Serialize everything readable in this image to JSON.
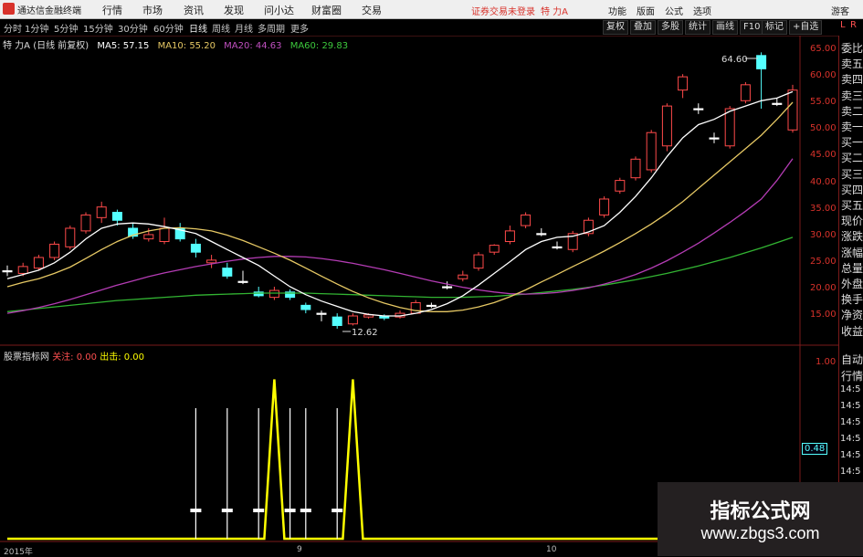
{
  "titlebar": {
    "app_name": "通达信金融终端",
    "menus": [
      "行情",
      "市场",
      "资讯",
      "发现",
      "问小达",
      "财富圈",
      "交易"
    ],
    "warning": "证券交易未登录",
    "stock": "特 力A",
    "right_buttons": [
      "功能",
      "版面",
      "公式",
      "选项"
    ],
    "user": "游客"
  },
  "periodbar": {
    "periods": [
      "分时",
      "1分钟",
      "5分钟",
      "15分钟",
      "30分钟",
      "60分钟",
      "日线",
      "周线",
      "月线",
      "多周期",
      "更多"
    ],
    "active": "日线",
    "tools": [
      "复权",
      "叠加",
      "多股",
      "统计",
      "画线",
      "F10",
      "标记",
      "+自选"
    ]
  },
  "ma_legend": {
    "title": "特 力A (日线 前复权)",
    "ma5": "MA5: 57.15",
    "ma10": "MA10: 55.20",
    "ma20": "MA20: 44.63",
    "ma60": "MA60: 29.83"
  },
  "colors": {
    "ma5": "#ffffff",
    "ma10": "#e6c864",
    "ma20": "#b43cb4",
    "ma60": "#32b432",
    "up": "#ff4a4a",
    "down": "#54ffff",
    "axis": "#d8322b",
    "indicator": "#ffff00"
  },
  "price_axis": [
    "65.00",
    "60.00",
    "55.00",
    "50.00",
    "45.00",
    "40.00",
    "35.00",
    "30.00",
    "25.00",
    "20.00",
    "15.00"
  ],
  "annotations": {
    "high": "64.60",
    "low": "12.62"
  },
  "lower_legend": {
    "name": "股票指标网",
    "attention_label": "关注:",
    "attention_value": "0.00",
    "exit_label": "出击:",
    "exit_value": "0.00"
  },
  "lower_axis": [
    "1.00",
    "0.48"
  ],
  "x_labels": [
    "2015年",
    "9",
    "10"
  ],
  "right_panel": {
    "top": [
      "L",
      "R"
    ],
    "quote_items": [
      "委比",
      "卖五",
      "卖四",
      "卖三",
      "卖二",
      "卖一",
      "买一",
      "买二",
      "买三",
      "买四",
      "买五",
      "现价",
      "涨跌",
      "涨幅",
      "总量",
      "外盘",
      "换手",
      "净资",
      "收益"
    ],
    "lower_items": [
      "自动",
      "行情"
    ],
    "times": [
      "14:5",
      "14:5",
      "14:5",
      "14:5",
      "14:5",
      "14:5",
      "14:5",
      "14:5"
    ]
  },
  "watermark": {
    "line1": "指标公式网",
    "line2": "www.zbgs3.com"
  },
  "chart_data": {
    "type": "candlestick",
    "ylim": [
      12,
      67
    ],
    "candles": [
      {
        "o": 23.5,
        "c": 23.5,
        "h": 24.5,
        "l": 22.5,
        "dir": "flat"
      },
      {
        "o": 23.0,
        "c": 24.3,
        "h": 25.0,
        "l": 22.5,
        "dir": "up"
      },
      {
        "o": 24.0,
        "c": 26.0,
        "h": 26.5,
        "l": 23.5,
        "dir": "up"
      },
      {
        "o": 26.0,
        "c": 28.5,
        "h": 29.0,
        "l": 25.5,
        "dir": "up"
      },
      {
        "o": 28.0,
        "c": 31.5,
        "h": 32.0,
        "l": 27.5,
        "dir": "up"
      },
      {
        "o": 31.0,
        "c": 34.0,
        "h": 34.5,
        "l": 30.5,
        "dir": "up"
      },
      {
        "o": 33.5,
        "c": 35.5,
        "h": 36.5,
        "l": 32.5,
        "dir": "up"
      },
      {
        "o": 34.5,
        "c": 33.0,
        "h": 35.0,
        "l": 32.0,
        "dir": "down"
      },
      {
        "o": 31.5,
        "c": 30.0,
        "h": 32.5,
        "l": 29.5,
        "dir": "down"
      },
      {
        "o": 29.5,
        "c": 30.3,
        "h": 31.5,
        "l": 29.0,
        "dir": "up"
      },
      {
        "o": 29.0,
        "c": 31.5,
        "h": 33.5,
        "l": 28.5,
        "dir": "up"
      },
      {
        "o": 31.5,
        "c": 29.5,
        "h": 32.5,
        "l": 29.0,
        "dir": "down"
      },
      {
        "o": 28.5,
        "c": 27.0,
        "h": 29.5,
        "l": 26.0,
        "dir": "down"
      },
      {
        "o": 25.5,
        "c": 25.0,
        "h": 26.5,
        "l": 24.0,
        "dir": "up"
      },
      {
        "o": 24.0,
        "c": 22.5,
        "h": 25.0,
        "l": 22.0,
        "dir": "down"
      },
      {
        "o": 21.5,
        "c": 21.5,
        "h": 23.5,
        "l": 21.0,
        "dir": "flat"
      },
      {
        "o": 19.5,
        "c": 18.8,
        "h": 20.5,
        "l": 18.5,
        "dir": "down"
      },
      {
        "o": 18.5,
        "c": 19.8,
        "h": 20.5,
        "l": 18.0,
        "dir": "up"
      },
      {
        "o": 19.5,
        "c": 18.5,
        "h": 20.0,
        "l": 18.0,
        "dir": "down"
      },
      {
        "o": 17.0,
        "c": 16.2,
        "h": 17.5,
        "l": 15.5,
        "dir": "down"
      },
      {
        "o": 15.5,
        "c": 15.5,
        "h": 16.0,
        "l": 14.0,
        "dir": "flat"
      },
      {
        "o": 14.8,
        "c": 13.2,
        "h": 15.5,
        "l": 12.6,
        "dir": "down"
      },
      {
        "o": 13.5,
        "c": 15.0,
        "h": 15.5,
        "l": 13.2,
        "dir": "up"
      },
      {
        "o": 14.8,
        "c": 15.2,
        "h": 15.5,
        "l": 14.5,
        "dir": "up"
      },
      {
        "o": 15.0,
        "c": 14.6,
        "h": 15.3,
        "l": 14.2,
        "dir": "down"
      },
      {
        "o": 14.8,
        "c": 15.5,
        "h": 16.0,
        "l": 14.5,
        "dir": "up"
      },
      {
        "o": 15.5,
        "c": 17.5,
        "h": 18.0,
        "l": 15.5,
        "dir": "up"
      },
      {
        "o": 17.0,
        "c": 17.0,
        "h": 17.5,
        "l": 16.5,
        "dir": "flat"
      },
      {
        "o": 20.5,
        "c": 20.5,
        "h": 21.5,
        "l": 20.0,
        "dir": "flat"
      },
      {
        "o": 22.0,
        "c": 22.7,
        "h": 23.5,
        "l": 21.5,
        "dir": "up"
      },
      {
        "o": 24.0,
        "c": 26.5,
        "h": 27.0,
        "l": 23.5,
        "dir": "up"
      },
      {
        "o": 27.0,
        "c": 28.3,
        "h": 28.5,
        "l": 26.5,
        "dir": "up"
      },
      {
        "o": 29.0,
        "c": 31.0,
        "h": 32.0,
        "l": 28.5,
        "dir": "up"
      },
      {
        "o": 32.0,
        "c": 34.0,
        "h": 34.5,
        "l": 31.5,
        "dir": "up"
      },
      {
        "o": 30.5,
        "c": 30.5,
        "h": 31.5,
        "l": 30.0,
        "dir": "flat"
      },
      {
        "o": 28.0,
        "c": 28.0,
        "h": 29.0,
        "l": 27.5,
        "dir": "flat"
      },
      {
        "o": 27.5,
        "c": 30.5,
        "h": 31.0,
        "l": 27.0,
        "dir": "up"
      },
      {
        "o": 30.5,
        "c": 33.0,
        "h": 33.5,
        "l": 30.0,
        "dir": "up"
      },
      {
        "o": 34.0,
        "c": 37.0,
        "h": 37.5,
        "l": 33.5,
        "dir": "up"
      },
      {
        "o": 38.5,
        "c": 40.5,
        "h": 41.0,
        "l": 38.0,
        "dir": "up"
      },
      {
        "o": 41.0,
        "c": 44.5,
        "h": 45.0,
        "l": 40.5,
        "dir": "up"
      },
      {
        "o": 42.5,
        "c": 49.5,
        "h": 50.0,
        "l": 42.0,
        "dir": "up"
      },
      {
        "o": 47.0,
        "c": 54.5,
        "h": 55.0,
        "l": 46.0,
        "dir": "up"
      },
      {
        "o": 57.5,
        "c": 60.0,
        "h": 60.5,
        "l": 56.0,
        "dir": "up"
      },
      {
        "o": 54.0,
        "c": 54.0,
        "h": 55.0,
        "l": 53.0,
        "dir": "flat"
      },
      {
        "o": 48.5,
        "c": 48.5,
        "h": 49.5,
        "l": 47.5,
        "dir": "flat"
      },
      {
        "o": 47.0,
        "c": 54.0,
        "h": 54.5,
        "l": 46.5,
        "dir": "up"
      },
      {
        "o": 55.5,
        "c": 58.5,
        "h": 59.0,
        "l": 55.0,
        "dir": "up"
      },
      {
        "o": 61.5,
        "c": 64.0,
        "h": 64.6,
        "l": 54.0,
        "dir": "down"
      },
      {
        "o": 55.0,
        "c": 55.0,
        "h": 56.0,
        "l": 54.5,
        "dir": "flat"
      },
      {
        "o": 50.0,
        "c": 57.5,
        "h": 58.5,
        "l": 49.5,
        "dir": "up"
      }
    ],
    "ma5": [
      22.0,
      22.8,
      23.6,
      25.0,
      27.0,
      29.5,
      31.5,
      32.3,
      32.5,
      32.3,
      31.8,
      31.2,
      30.5,
      29.0,
      27.5,
      26.0,
      24.5,
      22.5,
      20.5,
      19.0,
      17.8,
      16.8,
      15.8,
      15.3,
      15.0,
      15.0,
      15.5,
      16.2,
      17.3,
      18.8,
      20.8,
      23.0,
      25.2,
      27.5,
      29.0,
      29.8,
      30.0,
      30.8,
      32.0,
      34.5,
      37.5,
      41.0,
      45.0,
      48.5,
      51.0,
      52.0,
      53.5,
      54.5,
      55.5,
      56.0,
      57.2
    ],
    "ma10": [
      20.5,
      21.3,
      22.0,
      23.0,
      24.2,
      25.8,
      27.5,
      29.0,
      30.2,
      31.0,
      31.5,
      31.6,
      31.4,
      31.0,
      30.2,
      29.2,
      28.0,
      26.8,
      25.5,
      24.0,
      22.5,
      21.0,
      19.6,
      18.4,
      17.4,
      16.6,
      16.0,
      15.8,
      15.8,
      16.1,
      16.7,
      17.5,
      18.6,
      19.9,
      21.4,
      22.8,
      24.3,
      25.7,
      27.2,
      28.8,
      30.5,
      32.3,
      34.3,
      36.5,
      39.0,
      41.5,
      44.0,
      46.5,
      49.0,
      52.0,
      55.2
    ],
    "ma20": [
      15.5,
      16.0,
      16.6,
      17.3,
      18.1,
      19.0,
      19.9,
      20.8,
      21.6,
      22.4,
      23.1,
      23.7,
      24.3,
      24.8,
      25.3,
      25.7,
      26.0,
      26.2,
      26.2,
      26.1,
      25.8,
      25.4,
      24.9,
      24.3,
      23.7,
      23.0,
      22.3,
      21.6,
      21.0,
      20.4,
      19.9,
      19.5,
      19.2,
      19.1,
      19.2,
      19.4,
      19.8,
      20.3,
      21.0,
      21.8,
      22.8,
      24.0,
      25.4,
      27.0,
      28.7,
      30.6,
      32.6,
      34.7,
      37.0,
      40.5,
      44.6
    ],
    "ma60": [
      15.8,
      16.1,
      16.4,
      16.7,
      17.0,
      17.3,
      17.6,
      17.9,
      18.1,
      18.3,
      18.5,
      18.7,
      18.9,
      19.0,
      19.1,
      19.2,
      19.3,
      19.3,
      19.3,
      19.3,
      19.2,
      19.1,
      19.0,
      18.9,
      18.8,
      18.7,
      18.6,
      18.5,
      18.5,
      18.5,
      18.6,
      18.7,
      18.9,
      19.1,
      19.4,
      19.7,
      20.0,
      20.4,
      20.8,
      21.3,
      21.8,
      22.4,
      23.0,
      23.7,
      24.4,
      25.2,
      26.0,
      26.9,
      27.8,
      28.8,
      29.8
    ],
    "indicator": {
      "ylim": [
        0,
        1.1
      ],
      "attention_peaks_x_index": [
        17,
        22
      ],
      "exit_signal_x_index": [
        12,
        14,
        16,
        18,
        19,
        21
      ]
    }
  }
}
